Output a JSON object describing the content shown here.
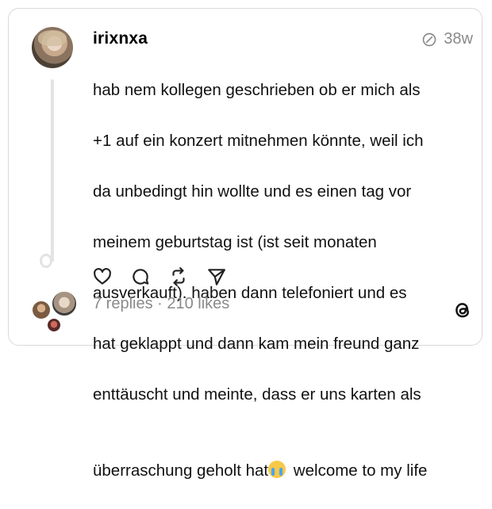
{
  "post": {
    "username": "irixnxa",
    "time": "38w",
    "text_lines": [
      "hab nem kollegen geschrieben ob er mich als",
      "+1 auf ein konzert mitnehmen könnte, weil ich",
      "da unbedingt hin wollte und es einen tag vor",
      "meinem geburtstag ist (ist seit monaten",
      "ausverkauft). haben dann telefoniert und es",
      "hat geklappt und dann kam mein freund ganz",
      "enttäuscht und meinte, dass er uns karten als",
      "überraschung geholt hat"
    ],
    "text_tail": " welcome to my life",
    "emoji": "loudly-crying-face",
    "stats": "7 replies · 210 likes"
  },
  "icons": {
    "time": "edited-clock-icon",
    "like": "heart-icon",
    "reply": "comment-icon",
    "repost": "repost-icon",
    "share": "send-icon",
    "brand": "threads-logo"
  }
}
